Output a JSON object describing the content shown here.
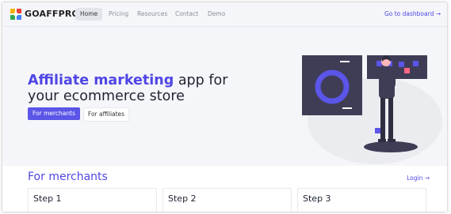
{
  "brand": {
    "name": "GOAFFPRO"
  },
  "nav": {
    "links": [
      "Home",
      "Pricing",
      "Resources",
      "Contact",
      "Demo"
    ],
    "dashboard": "Go to dashboard →"
  },
  "hero": {
    "headline_highlight": "Affiliate marketing",
    "headline_rest_1": " app for",
    "headline_rest_2": "your ecommerce store",
    "primary_button": "For merchants",
    "secondary_button": "For affiliates"
  },
  "merchants": {
    "title": "For merchants",
    "login": "Login →",
    "steps": [
      "Step 1",
      "Step 2",
      "Step 3"
    ]
  },
  "colors": {
    "accent": "#4f46e5",
    "hero_bg": "#f5f6f9",
    "illustration_dark": "#3f3d56"
  }
}
